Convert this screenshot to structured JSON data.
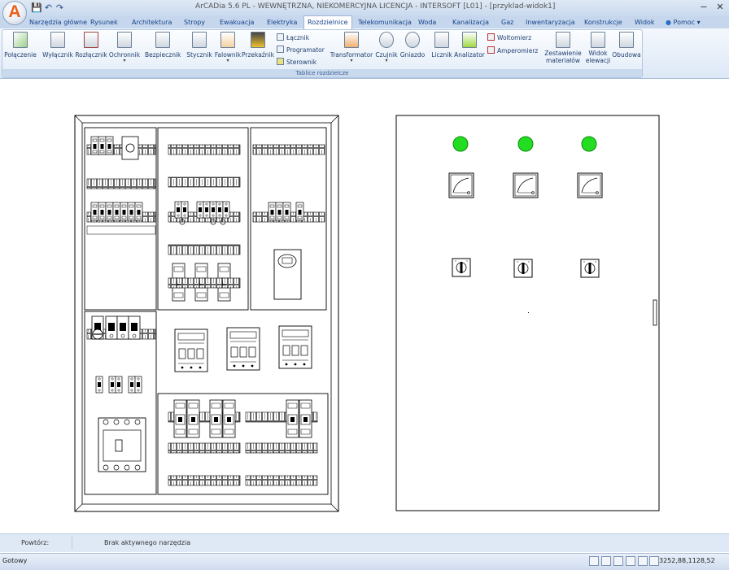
{
  "window": {
    "title": "ArCADia 5.6 PL - WEWNĘTRZNA, NIEKOMERCYJNA LICENCJA - INTERSOFT [L01] - [przyklad-widok1]",
    "logo_letter": "A",
    "minimize": "−",
    "close": "✕"
  },
  "quick_access": {
    "save": "💾",
    "undo": "↶",
    "redo": "↷"
  },
  "tabs": [
    "Narzędzia główne",
    "Rysunek",
    "Architektura",
    "Stropy",
    "Ewakuacja",
    "Elektryka",
    "Rozdzielnice",
    "Telekomunikacja",
    "Woda",
    "Kanalizacja",
    "Gaz",
    "Inwentaryzacja",
    "Konstrukcje",
    "Widok"
  ],
  "active_tab": "Rozdzielnice",
  "help": "Pomoc",
  "ribbon": {
    "group_label": "Tablice rozdzielcze",
    "buttons": [
      {
        "label": "Połączenie",
        "dropdown": false
      },
      {
        "label": "Wyłącznik",
        "dropdown": false
      },
      {
        "label": "Rozłącznik",
        "dropdown": false
      },
      {
        "label": "Ochronnik",
        "dropdown": true
      },
      {
        "label": "Bezpiecznik",
        "dropdown": false
      },
      {
        "label": "Stycznik",
        "dropdown": false
      },
      {
        "label": "Falownik",
        "dropdown": true
      },
      {
        "label": "Przekaźnik",
        "dropdown": false
      },
      {
        "label": "Transformator",
        "dropdown": true
      },
      {
        "label": "Czujnik",
        "dropdown": true
      },
      {
        "label": "Gniazdo",
        "dropdown": false
      },
      {
        "label": "Licznik",
        "dropdown": false
      },
      {
        "label": "Analizator",
        "dropdown": false
      },
      {
        "label": "Zestawienie materiałów",
        "dropdown": false
      },
      {
        "label": "Widok elewacji",
        "dropdown": false
      },
      {
        "label": "Obudowa",
        "dropdown": false
      }
    ],
    "small_buttons": [
      "Łącznik",
      "Programator",
      "Sterownik",
      "Woltomierz",
      "Amperomierz"
    ]
  },
  "command_bar": {
    "label": "Powtórz:",
    "status": "Brak aktywnego narzędzia"
  },
  "status_bar": {
    "text": "Gotowy",
    "coordinates": "3252,88,1128,52"
  },
  "colors": {
    "ribbon_bg": "#dde8f6",
    "tab_text": "#15428b",
    "indicator_green": "#22dd22"
  }
}
